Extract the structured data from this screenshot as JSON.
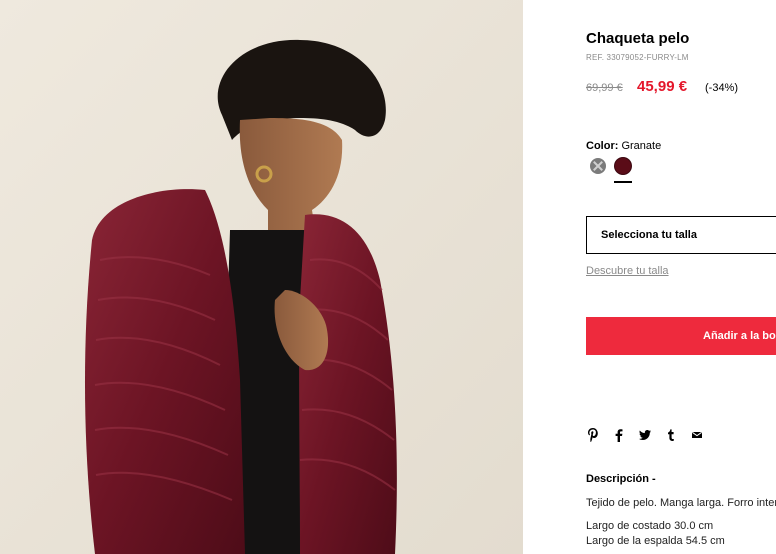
{
  "product": {
    "title": "Chaqueta pelo",
    "reference": "REF. 33079052-FURRY-LM",
    "old_price": "69,99 €",
    "new_price": "45,99 €",
    "discount": "(-34%)",
    "image_alt_colors": {
      "background": "#ebe5d9",
      "jacket": "#6e1424"
    }
  },
  "color": {
    "label": "Color:",
    "selected": "Granate",
    "swatches": [
      {
        "name": "grey",
        "hex": "#7b7b7b",
        "available": false
      },
      {
        "name": "Granate",
        "hex": "#5a0c17",
        "available": true,
        "selected": true
      }
    ]
  },
  "size": {
    "select_label": "Selecciona tu talla",
    "guide_link": "Descubre tu talla"
  },
  "cart": {
    "add_label": "Añadir a la bolsa",
    "accent": "#ee2a3d"
  },
  "share": {
    "icons": [
      "pinterest-icon",
      "facebook-icon",
      "twitter-icon",
      "tumblr-icon",
      "email-icon"
    ]
  },
  "description": {
    "title": "Descripción -",
    "text": "Tejido de pelo. Manga larga. Forro interior.",
    "measure_side": "Largo de costado 30.0 cm",
    "measure_back": "Largo de la espalda 54.5 cm"
  },
  "colors": {
    "price_red": "#e4172b",
    "muted_grey": "#8a8a8a"
  }
}
